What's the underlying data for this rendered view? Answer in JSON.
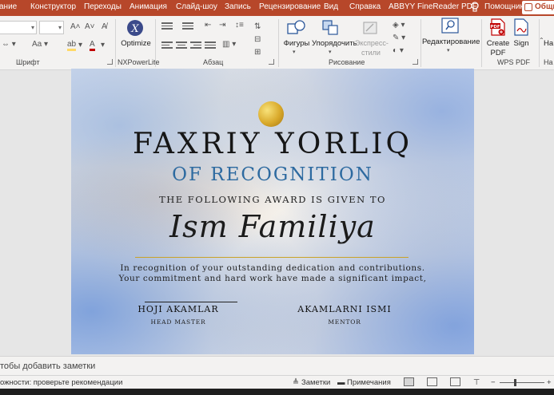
{
  "tabs": [
    "ание",
    "Конструктор",
    "Переходы",
    "Анимация",
    "Слайд-шоу",
    "Запись",
    "Рецензирование",
    "Вид",
    "Справка",
    "ABBYY FineReader PDF",
    "Помощник",
    "Общий"
  ],
  "ribbon": {
    "groups": {
      "font": "Шрифт",
      "nxpowerlite": "NXPowerLite",
      "paragraph": "Абзац",
      "drawing": "Рисование",
      "wps_pdf": "WPS PDF",
      "partial": "На"
    },
    "buttons": {
      "optimize": "Optimize",
      "shapes": "Фигуры",
      "arrange": "Упорядочить",
      "quick_styles_line1": "Экспресс-",
      "quick_styles_line2": "стили",
      "editing": "Редактирование",
      "create_pdf_line1": "Create",
      "create_pdf_line2": "PDF",
      "sign": "Sign",
      "partial": "На"
    },
    "font_color": "#c00000",
    "highlight_color": "#ffd966"
  },
  "slide": {
    "title": "FAXRIY YORLIQ",
    "subtitle": "OF RECOGNITION",
    "given_line": "THE FOLLOWING AWARD IS GIVEN TO",
    "recipient": "Ism Familiya",
    "body_line1": "In recognition of your outstanding dedication and contributions.",
    "body_line2": "Your commitment and hard work have made a significant impact,",
    "signatures": [
      {
        "name": "HOJI AKAMLAR",
        "role": "HEAD MASTER"
      },
      {
        "name": "AKAMLARNI ISMI",
        "role": "MENTOR"
      }
    ],
    "accent_color": "#2d6aa0",
    "gold_color": "#c9a227"
  },
  "notes": {
    "placeholder": "тобы добавить заметки"
  },
  "status": {
    "accessibility": "ожности: проверьте рекомендации",
    "notes_label": "Заметки",
    "comments_label": "Примечания"
  }
}
